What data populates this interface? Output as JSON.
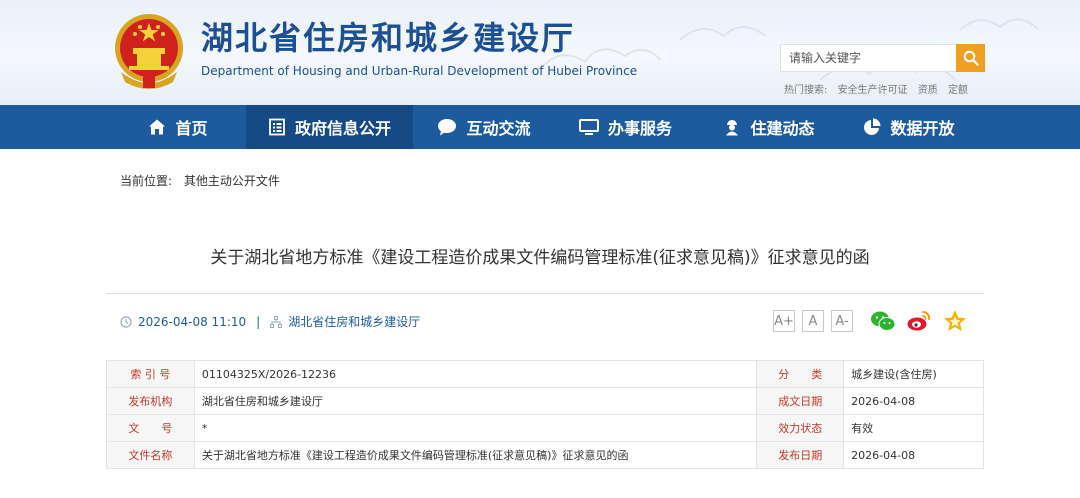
{
  "header": {
    "title": "湖北省住房和城乡建设厅",
    "subtitle": "Department of Housing and Urban-Rural Development of Hubei Province",
    "search_placeholder": "请输入关键字",
    "hot_search_label": "热门搜索:",
    "hot_terms": [
      "安全生产许可证",
      "资质",
      "定额"
    ]
  },
  "nav": {
    "items": [
      {
        "label": "首页",
        "icon": "home-icon"
      },
      {
        "label": "政府信息公开",
        "icon": "document-list-icon"
      },
      {
        "label": "互动交流",
        "icon": "chat-bubble-icon"
      },
      {
        "label": "办事服务",
        "icon": "monitor-icon"
      },
      {
        "label": "住建动态",
        "icon": "worker-icon"
      },
      {
        "label": "数据开放",
        "icon": "pie-chart-icon"
      }
    ],
    "active_index": 1
  },
  "breadcrumb": {
    "label": "当前位置:",
    "current": "其他主动公开文件"
  },
  "article": {
    "title": "关于湖北省地方标准《建设工程造价成果文件编码管理标准(征求意见稿)》征求意见的函",
    "datetime": "2026-04-08 11:10",
    "separator": "|",
    "source": "湖北省住房和城乡建设厅",
    "font_sizes": [
      "A+",
      "A",
      "A-"
    ]
  },
  "info_table": {
    "rows": [
      {
        "k1": "索 引 号",
        "v1": "01104325X/2026-12236",
        "k2": "分　　类",
        "v2": "城乡建设(含住房)"
      },
      {
        "k1": "发布机构",
        "v1": "湖北省住房和城乡建设厅",
        "k2": "成文日期",
        "v2": "2026-04-08"
      },
      {
        "k1": "文　　号",
        "v1": "*",
        "k2": "效力状态",
        "v2": "有效"
      },
      {
        "k1": "文件名称",
        "v1": "关于湖北省地方标准《建设工程造价成果文件编码管理标准(征求意见稿)》征求意见的函",
        "k2": "发布日期",
        "v2": "2026-04-08"
      }
    ]
  },
  "colors": {
    "nav_bg": "#1e5b9e",
    "nav_active_bg": "#164a85",
    "title_blue": "#1c4f93",
    "search_button": "#f0a020",
    "table_key_text": "#c0392b"
  }
}
